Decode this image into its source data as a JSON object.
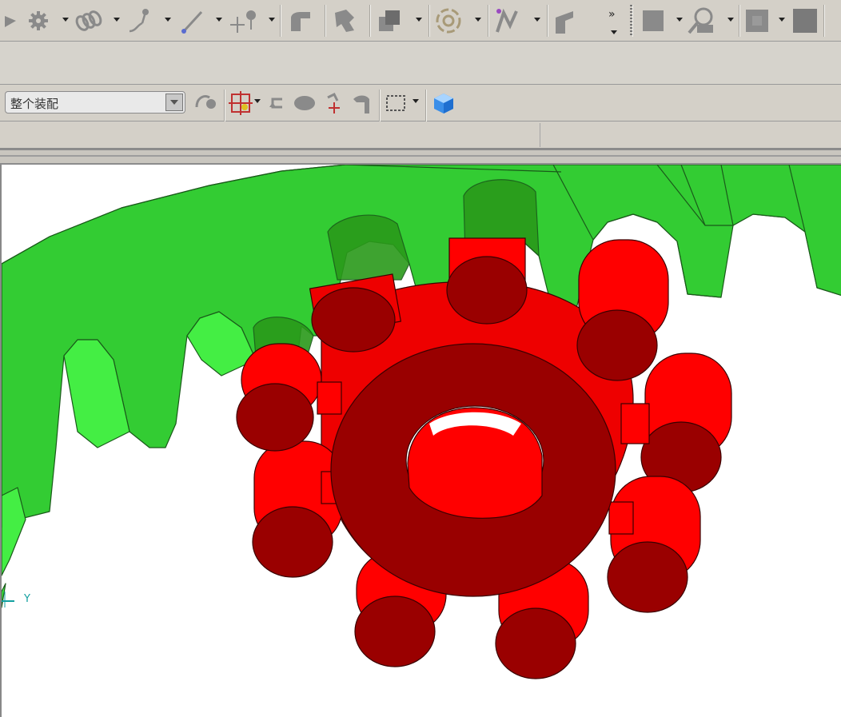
{
  "app": {
    "assembly_selector": {
      "value": "整个装配"
    }
  },
  "toolbar_main": {
    "icons": [
      "gear-icon",
      "spring-icon",
      "sketch-icon",
      "line-icon",
      "point-icon",
      "bend-icon",
      "joint-icon",
      "block-icon",
      "rotate-pattern-icon",
      "path-icon",
      "sheet-icon",
      "more-icon",
      "face-icon",
      "probe-icon",
      "square-icon",
      "square-fill-icon"
    ]
  },
  "toolbar_gears": {
    "icons": [
      "rack-icon",
      "spur-gear-icon",
      "ring-gear-icon",
      "double-gear-icon",
      "star-gear-icon",
      "cylinder-gear-icon",
      "worm-gear-icon",
      "chain-icon",
      "bearing-icon",
      "gear-pair-icon",
      "shaft-icon",
      "cam-icon",
      "link-icon",
      "ring-icon",
      "bevel-icon",
      "sprocket-icon",
      "spline-icon",
      "sun-gear-icon",
      "star-wheel-icon",
      "pin-gear-icon",
      "roller-icon",
      "sprocket-outline-icon",
      "wheel-icon",
      "rack-gear-icon"
    ]
  },
  "toolbar_view": {
    "icons": [
      "assembly-constraint-icon",
      "reposition-icon",
      "undo-icon",
      "cloud-icon",
      "move-icon",
      "drag-icon",
      "select-box-icon",
      "cube-icon"
    ]
  },
  "viewport": {
    "axis_label": "Y",
    "colors": {
      "rack_green": "#33cc33",
      "pin_gear_red": "#ff0000",
      "face_dark": "#990000",
      "rack_edge": "#1a7f1a"
    }
  }
}
